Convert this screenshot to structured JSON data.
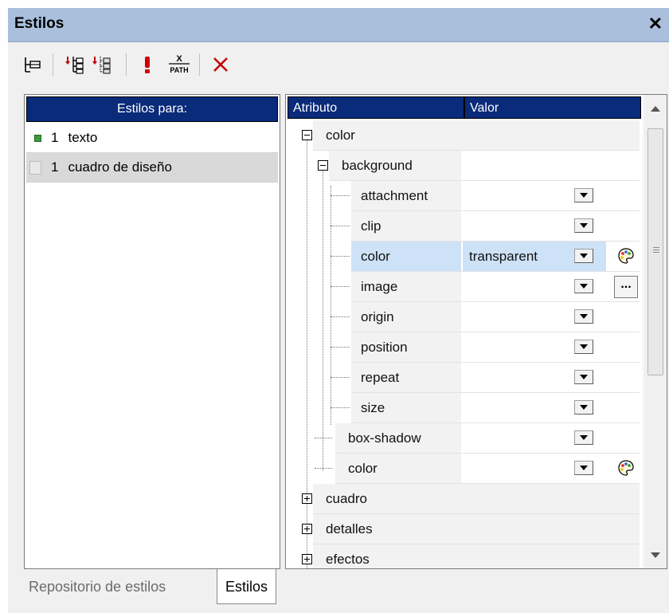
{
  "panel": {
    "title": "Estilos",
    "close_label": "✕"
  },
  "toolbar": {
    "icons": [
      "tree-view-icon",
      "add-style-icon",
      "add-style-repository-icon",
      "exclamation-icon",
      "xpath-icon",
      "delete-icon"
    ],
    "xpath_label_top": "X",
    "xpath_label_bottom": "PATH"
  },
  "styles_for": {
    "header": "Estilos para:",
    "items": [
      {
        "count": "1",
        "label": "texto"
      },
      {
        "count": "1",
        "label": "cuadro de diseño"
      }
    ]
  },
  "grid": {
    "col_attribute": "Atributo",
    "col_value": "Valor",
    "rows": [
      {
        "label": "color",
        "level": 0,
        "expanded": true
      },
      {
        "label": "background",
        "level": 1,
        "expanded": true
      },
      {
        "label": "attachment",
        "level": 2,
        "value": ""
      },
      {
        "label": "clip",
        "level": 2,
        "value": ""
      },
      {
        "label": "color",
        "level": 2,
        "value": "transparent",
        "selected": true
      },
      {
        "label": "image",
        "level": 2,
        "value": ""
      },
      {
        "label": "origin",
        "level": 2,
        "value": ""
      },
      {
        "label": "position",
        "level": 2,
        "value": ""
      },
      {
        "label": "repeat",
        "level": 2,
        "value": ""
      },
      {
        "label": "size",
        "level": 2,
        "value": ""
      },
      {
        "label": "box-shadow",
        "level": 1,
        "value": ""
      },
      {
        "label": "color",
        "level": 1,
        "value": ""
      },
      {
        "label": "cuadro",
        "level": 0,
        "expanded": false
      },
      {
        "label": "detalles",
        "level": 0,
        "expanded": false
      },
      {
        "label": "efectos",
        "level": 0,
        "expanded": false
      }
    ],
    "ellipsis_label": "..."
  },
  "tabs": {
    "repository": "Repositorio de estilos",
    "styles": "Estilos",
    "active": "Estilos"
  },
  "colors": {
    "titlebar": "#a9bfdc",
    "header_bg": "#0a2a7a",
    "selected_row": "#cde2f7"
  }
}
